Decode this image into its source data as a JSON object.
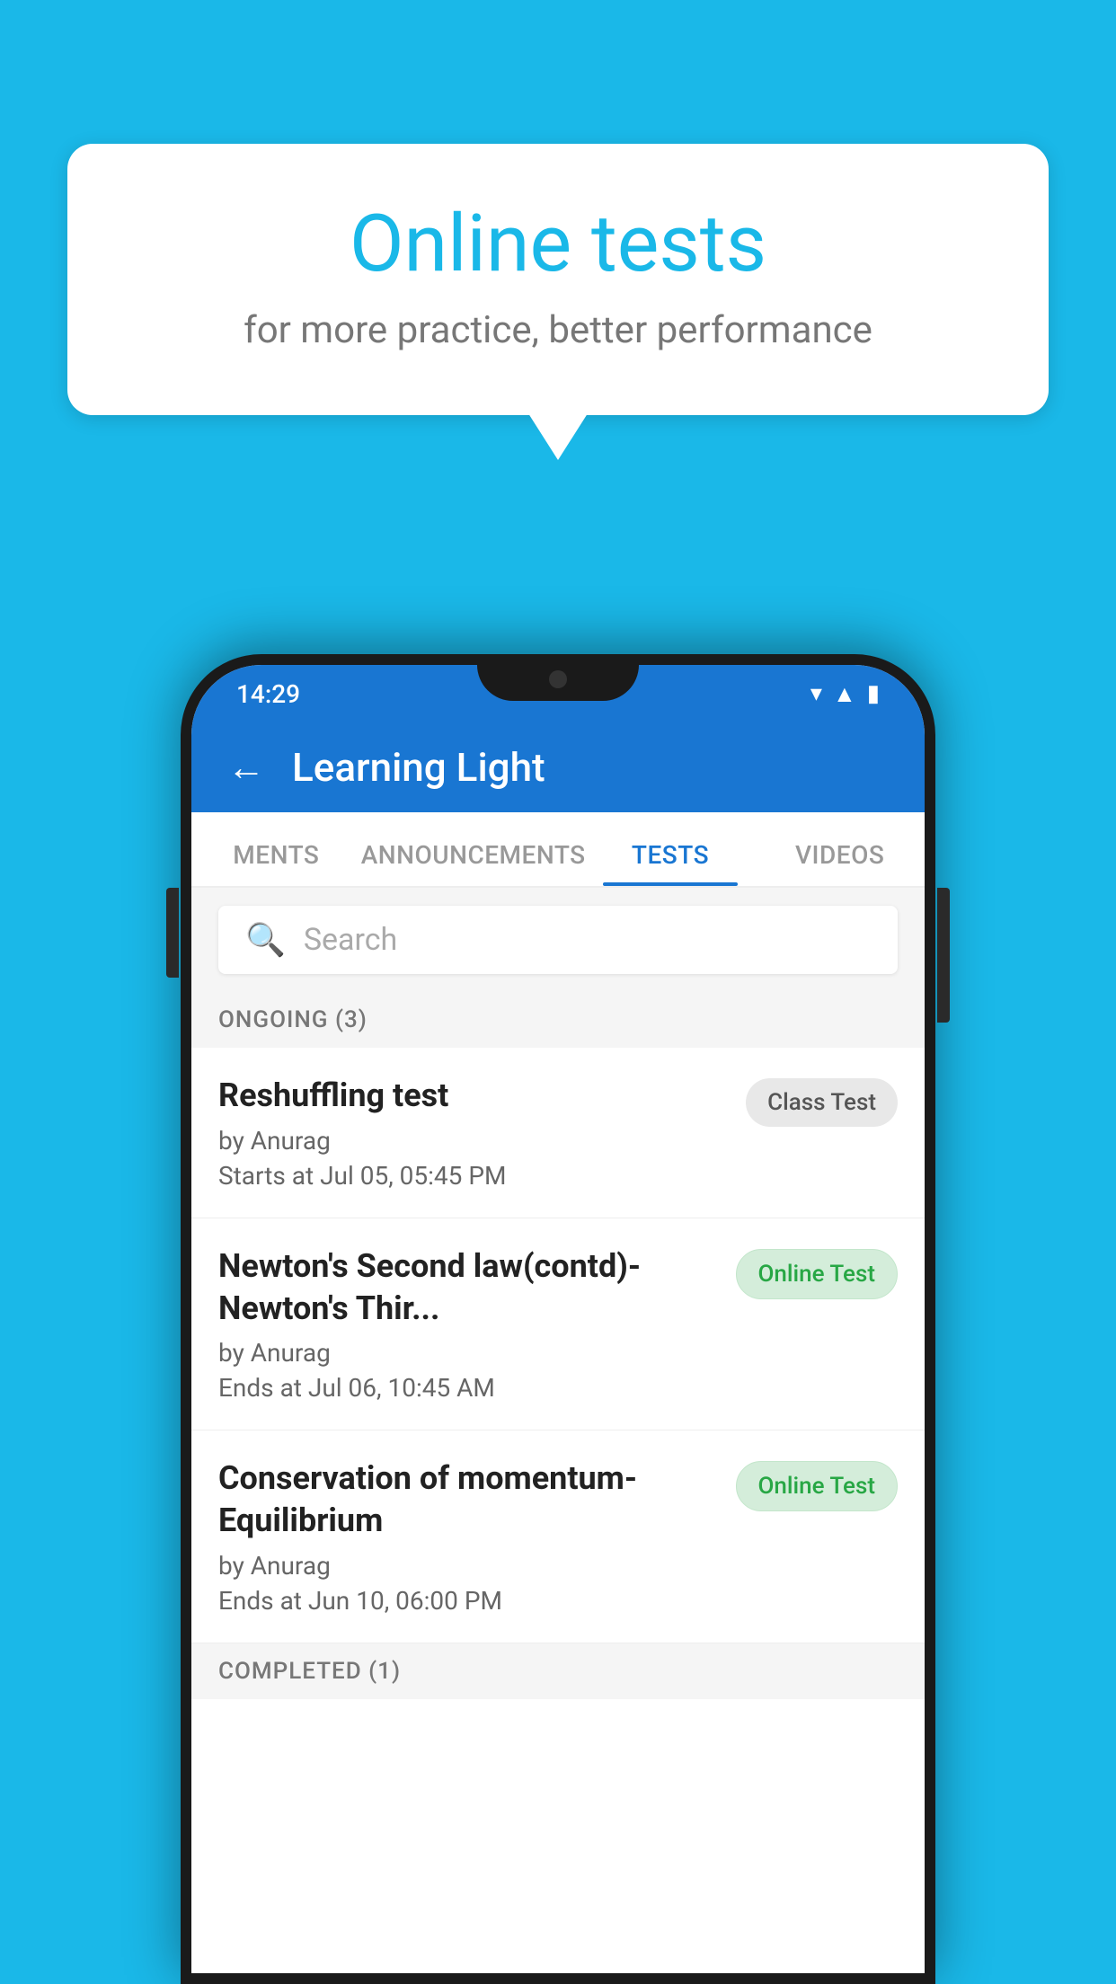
{
  "background_color": "#1ab8e8",
  "promo": {
    "title": "Online tests",
    "subtitle": "for more practice, better performance"
  },
  "phone": {
    "status_bar": {
      "time": "14:29"
    },
    "app_bar": {
      "back_label": "←",
      "title": "Learning Light"
    },
    "tabs": [
      {
        "label": "MENTS",
        "active": false
      },
      {
        "label": "ANNOUNCEMENTS",
        "active": false
      },
      {
        "label": "TESTS",
        "active": true
      },
      {
        "label": "VIDEOS",
        "active": false
      }
    ],
    "search": {
      "placeholder": "Search"
    },
    "ongoing_section": {
      "label": "ONGOING (3)"
    },
    "tests": [
      {
        "name": "Reshuffling test",
        "author": "by Anurag",
        "date_label": "Starts at",
        "date": "Jul 05, 05:45 PM",
        "badge": "Class Test",
        "badge_type": "class"
      },
      {
        "name": "Newton's Second law(contd)-Newton's Thir...",
        "author": "by Anurag",
        "date_label": "Ends at",
        "date": "Jul 06, 10:45 AM",
        "badge": "Online Test",
        "badge_type": "online"
      },
      {
        "name": "Conservation of momentum-Equilibrium",
        "author": "by Anurag",
        "date_label": "Ends at",
        "date": "Jun 10, 06:00 PM",
        "badge": "Online Test",
        "badge_type": "online"
      }
    ],
    "completed_section": {
      "label": "COMPLETED (1)"
    }
  }
}
